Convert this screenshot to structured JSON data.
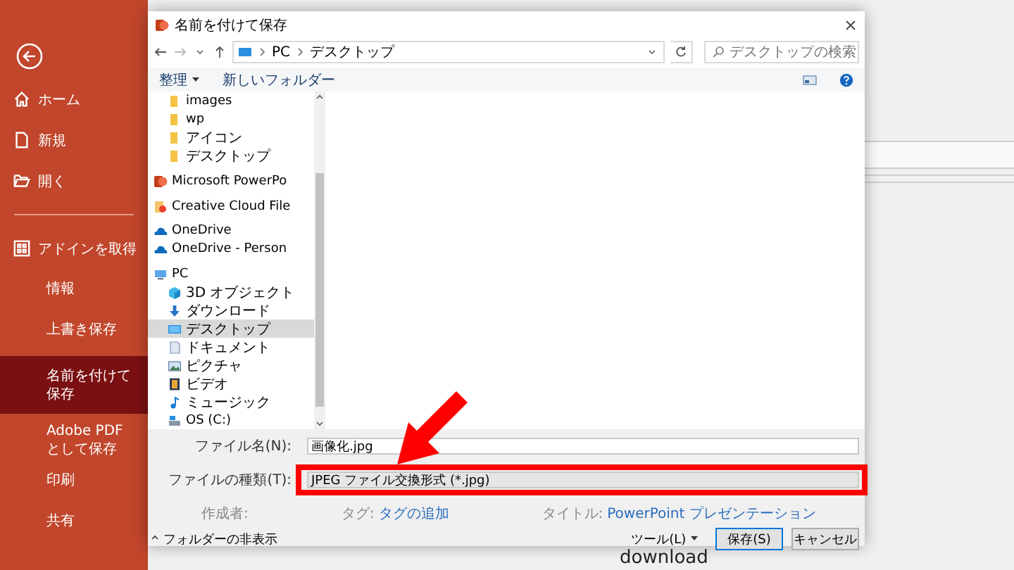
{
  "sidebar": {
    "items": [
      {
        "kind": "back"
      },
      {
        "kind": "home",
        "label": "ホーム",
        "selected": false
      },
      {
        "kind": "new",
        "label": "新規",
        "selected": false
      },
      {
        "kind": "open",
        "label": "開く",
        "selected": false
      },
      {
        "kind": "divider"
      },
      {
        "kind": "addin",
        "label": "アドインを取得",
        "selected": false
      },
      {
        "kind": "text",
        "label": "情報",
        "selected": false
      },
      {
        "kind": "text",
        "label": "上書き保存",
        "selected": false
      },
      {
        "kind": "text",
        "label": "名前を付けて保存",
        "selected": true
      },
      {
        "kind": "text",
        "label": "Adobe PDF として保存",
        "selected": false
      },
      {
        "kind": "text",
        "label": "印刷",
        "selected": false
      },
      {
        "kind": "text",
        "label": "共有",
        "selected": false
      }
    ]
  },
  "background": {
    "text": "download"
  },
  "dialog": {
    "title": "名前を付けて保存",
    "address": {
      "path": [
        "PC",
        "デスクトップ"
      ]
    },
    "search": {
      "placeholder": "デスクトップの検索"
    },
    "toolbar": {
      "organize": "整理",
      "new_folder": "新しいフォルダー"
    },
    "nav_items": [
      {
        "kind": "folder",
        "label": "images",
        "selected": false
      },
      {
        "kind": "folder",
        "label": "wp",
        "selected": false
      },
      {
        "kind": "folder",
        "label": "アイコン",
        "selected": false
      },
      {
        "kind": "folder",
        "label": "デスクトップ",
        "selected": false
      },
      {
        "kind": "powerpoint",
        "label": "Microsoft PowerPo",
        "selected": false
      },
      {
        "kind": "creative",
        "label": "Creative Cloud File",
        "selected": false
      },
      {
        "kind": "cloud",
        "label": "OneDrive",
        "selected": false
      },
      {
        "kind": "cloud",
        "label": "OneDrive - Person",
        "selected": false
      },
      {
        "kind": "pc",
        "label": "PC",
        "selected": false,
        "children": [
          {
            "kind": "cube",
            "label": "3D オブジェクト",
            "selected": false
          },
          {
            "kind": "download",
            "label": "ダウンロード",
            "selected": false
          },
          {
            "kind": "desktop",
            "label": "デスクトップ",
            "selected": true
          },
          {
            "kind": "document",
            "label": "ドキュメント",
            "selected": false
          },
          {
            "kind": "picture",
            "label": "ピクチャ",
            "selected": false
          },
          {
            "kind": "video",
            "label": "ビデオ",
            "selected": false
          },
          {
            "kind": "music",
            "label": "ミュージック",
            "selected": false
          },
          {
            "kind": "drive",
            "label": "OS (C:)",
            "selected": false
          }
        ]
      }
    ],
    "file_name": {
      "label": "ファイル名(N):",
      "value": "画像化.jpg"
    },
    "file_type": {
      "label": "ファイルの種類(T):",
      "value": "JPEG ファイル交換形式 (*.jpg)"
    },
    "meta": [
      {
        "label": "作成者:"
      },
      {
        "label": "タグ:",
        "value": "タグの追加"
      },
      {
        "label": "タイトル:",
        "value": "PowerPoint プレゼンテーション"
      }
    ],
    "hide_folders": "フォルダーの非表示",
    "tools": "ツール(L)",
    "buttons": [
      {
        "kind": "primary",
        "label": "保存(S)"
      },
      {
        "kind": "normal",
        "label": "キャンセル"
      }
    ]
  }
}
